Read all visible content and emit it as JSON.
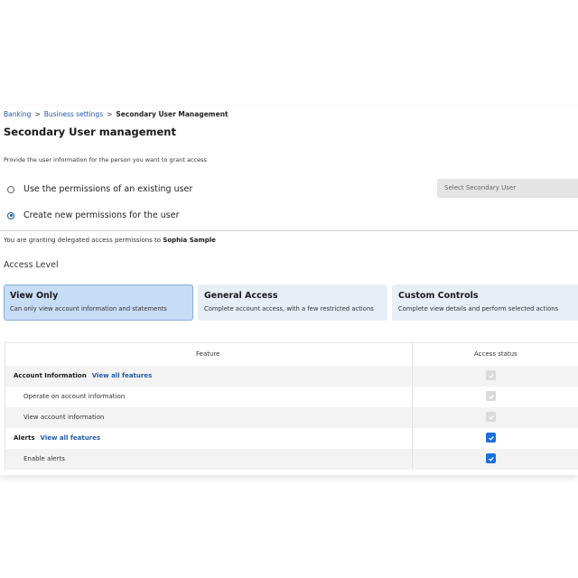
{
  "breadcrumb": {
    "items": [
      "Banking",
      "Business settings"
    ],
    "separator": ">",
    "current": "Secondary User Management"
  },
  "page_title": "Secondary User management",
  "instruction": "Provide the user information for the person you want to grant access",
  "options": {
    "existing": {
      "label": "Use the permissions of an existing user",
      "selected": false
    },
    "new": {
      "label": "Create new permissions for the user",
      "selected": true
    }
  },
  "select_user": {
    "placeholder": "Select Secondary User"
  },
  "granting": {
    "prefix": "You are granting delegated access permissions to",
    "name": "Sophia Sample"
  },
  "access_level": {
    "label": "Access Level",
    "cards": [
      {
        "title": "View Only",
        "description": "Can only view account information and statements",
        "selected": true
      },
      {
        "title": "General Access",
        "description": "Complete account access, with a few restricted actions",
        "selected": false
      },
      {
        "title": "Custom Controls",
        "description": "Complete view details and perform selected actions",
        "selected": false
      }
    ]
  },
  "table": {
    "headers": {
      "feature": "Feature",
      "status": "Access status"
    },
    "rows": [
      {
        "label": "Account Information",
        "link": "View all features",
        "checked": true,
        "enabled": false
      },
      {
        "label": "Operate on account information",
        "checked": true,
        "enabled": false
      },
      {
        "label": "View account information",
        "checked": true,
        "enabled": false
      },
      {
        "label": "Alerts",
        "link": "View all features",
        "checked": true,
        "enabled": true
      },
      {
        "label": "Enable alerts",
        "checked": true,
        "enabled": true
      }
    ]
  },
  "colors": {
    "link": "#1f5aa6",
    "selected_card_bg": "#c7dcf5",
    "card_bg": "#e6eef7",
    "checkbox_active": "#1a6fe0"
  },
  "icons": [
    "radio-unchecked-icon",
    "radio-checked-icon",
    "checkbox-checked-icon"
  ]
}
